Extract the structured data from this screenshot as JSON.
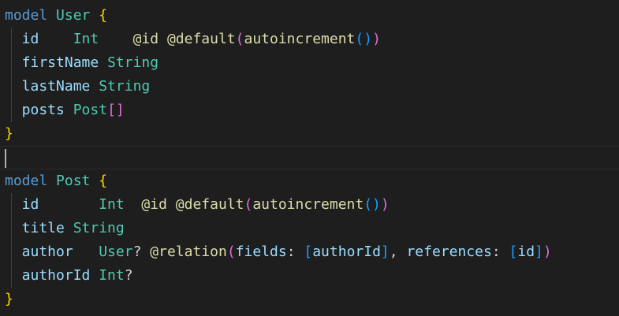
{
  "colors": {
    "background": "#1e1e1e",
    "keyword": "#569cd6",
    "model_name": "#4ec9b0",
    "field": "#9cdcfe",
    "type": "#4ec9b0",
    "attribute": "#dcdcaa",
    "function": "#dcdcaa",
    "plain": "#d4d4d4",
    "brace": "#ffd700",
    "paren": "#da70d6",
    "bracket": "#da70d6",
    "bracket_inner": "#179fff",
    "cursor": "#aeafad"
  },
  "lines": [
    {
      "indent": false,
      "tokens": [
        {
          "t": "model",
          "c": "keyword"
        },
        {
          "t": " ",
          "c": "plain"
        },
        {
          "t": "User",
          "c": "model_name"
        },
        {
          "t": " ",
          "c": "plain"
        },
        {
          "t": "{",
          "c": "brace"
        }
      ]
    },
    {
      "indent": true,
      "tokens": [
        {
          "t": "  id",
          "c": "field"
        },
        {
          "t": "    ",
          "c": "plain"
        },
        {
          "t": "Int",
          "c": "type"
        },
        {
          "t": "    ",
          "c": "plain"
        },
        {
          "t": "@id",
          "c": "attribute"
        },
        {
          "t": " ",
          "c": "plain"
        },
        {
          "t": "@default",
          "c": "attribute"
        },
        {
          "t": "(",
          "c": "paren"
        },
        {
          "t": "autoincrement",
          "c": "function"
        },
        {
          "t": "()",
          "c": "bracket_inner"
        },
        {
          "t": ")",
          "c": "paren"
        }
      ]
    },
    {
      "indent": true,
      "tokens": [
        {
          "t": "  firstName",
          "c": "field"
        },
        {
          "t": " ",
          "c": "plain"
        },
        {
          "t": "String",
          "c": "type"
        }
      ]
    },
    {
      "indent": true,
      "tokens": [
        {
          "t": "  lastName",
          "c": "field"
        },
        {
          "t": " ",
          "c": "plain"
        },
        {
          "t": "String",
          "c": "type"
        }
      ]
    },
    {
      "indent": true,
      "tokens": [
        {
          "t": "  posts",
          "c": "field"
        },
        {
          "t": " ",
          "c": "plain"
        },
        {
          "t": "Post",
          "c": "type"
        },
        {
          "t": "[]",
          "c": "bracket"
        }
      ]
    },
    {
      "indent": false,
      "tokens": [
        {
          "t": "}",
          "c": "brace"
        }
      ]
    },
    {
      "indent": false,
      "current": true,
      "tokens": []
    },
    {
      "indent": false,
      "tokens": [
        {
          "t": "model",
          "c": "keyword"
        },
        {
          "t": " ",
          "c": "plain"
        },
        {
          "t": "Post",
          "c": "model_name"
        },
        {
          "t": " ",
          "c": "plain"
        },
        {
          "t": "{",
          "c": "brace"
        }
      ]
    },
    {
      "indent": true,
      "tokens": [
        {
          "t": "  id",
          "c": "field"
        },
        {
          "t": "       ",
          "c": "plain"
        },
        {
          "t": "Int",
          "c": "type"
        },
        {
          "t": "  ",
          "c": "plain"
        },
        {
          "t": "@id",
          "c": "attribute"
        },
        {
          "t": " ",
          "c": "plain"
        },
        {
          "t": "@default",
          "c": "attribute"
        },
        {
          "t": "(",
          "c": "paren"
        },
        {
          "t": "autoincrement",
          "c": "function"
        },
        {
          "t": "()",
          "c": "bracket_inner"
        },
        {
          "t": ")",
          "c": "paren"
        }
      ]
    },
    {
      "indent": true,
      "tokens": [
        {
          "t": "  title",
          "c": "field"
        },
        {
          "t": " ",
          "c": "plain"
        },
        {
          "t": "String",
          "c": "type"
        }
      ]
    },
    {
      "indent": true,
      "tokens": [
        {
          "t": "  author",
          "c": "field"
        },
        {
          "t": "   ",
          "c": "plain"
        },
        {
          "t": "User",
          "c": "type"
        },
        {
          "t": "?",
          "c": "plain"
        },
        {
          "t": " ",
          "c": "plain"
        },
        {
          "t": "@relation",
          "c": "attribute"
        },
        {
          "t": "(",
          "c": "paren"
        },
        {
          "t": "fields",
          "c": "field"
        },
        {
          "t": ": ",
          "c": "plain"
        },
        {
          "t": "[",
          "c": "bracket_inner"
        },
        {
          "t": "authorId",
          "c": "field"
        },
        {
          "t": "]",
          "c": "bracket_inner"
        },
        {
          "t": ", ",
          "c": "plain"
        },
        {
          "t": "references",
          "c": "field"
        },
        {
          "t": ": ",
          "c": "plain"
        },
        {
          "t": "[",
          "c": "bracket_inner"
        },
        {
          "t": "id",
          "c": "field"
        },
        {
          "t": "]",
          "c": "bracket_inner"
        },
        {
          "t": ")",
          "c": "paren"
        }
      ]
    },
    {
      "indent": true,
      "tokens": [
        {
          "t": "  authorId",
          "c": "field"
        },
        {
          "t": " ",
          "c": "plain"
        },
        {
          "t": "Int",
          "c": "type"
        },
        {
          "t": "?",
          "c": "plain"
        }
      ]
    },
    {
      "indent": false,
      "tokens": [
        {
          "t": "}",
          "c": "brace"
        }
      ]
    }
  ]
}
